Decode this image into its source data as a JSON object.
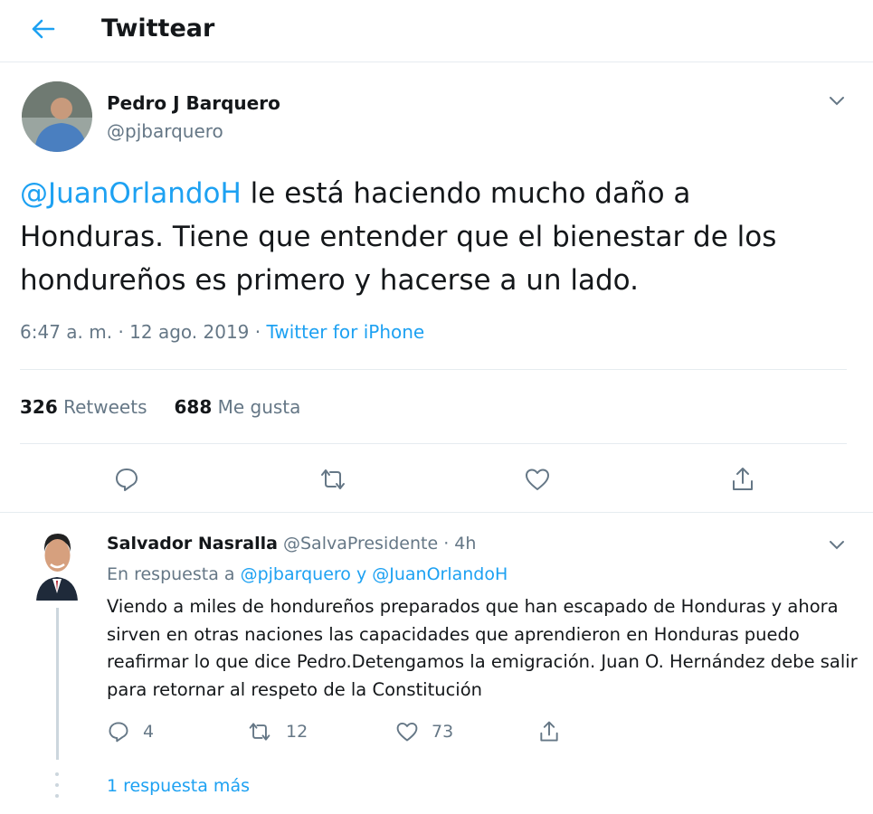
{
  "header": {
    "title": "Twittear"
  },
  "tweet": {
    "author_name": "Pedro J Barquero",
    "author_handle": "@pjbarquero",
    "mention": "@JuanOrlandoH",
    "text": " le está haciendo mucho daño a Honduras. Tiene que entender que el bienestar de los hondureños es primero y hacerse a un lado.",
    "time": "6:47 a. m. · 12 ago. 2019 · ",
    "source": "Twitter for iPhone",
    "retweets_count": "326",
    "retweets_label": "Retweets",
    "likes_count": "688",
    "likes_label": "Me gusta"
  },
  "reply": {
    "author_name": "Salvador Nasralla",
    "author_handle": "@SalvaPresidente · 4h",
    "in_reply_prefix": "En respuesta a ",
    "in_reply_mentions": "@pjbarquero y @JuanOrlandoH",
    "text": "Viendo a miles de hondureños preparados que han escapado de Honduras y ahora sirven en otras naciones las capacidades que aprendieron en Honduras puedo  reafirmar lo que dice Pedro.Detengamos la emigración. Juan O. Hernández debe salir para retornar al respeto de la Constitución",
    "replies_count": "4",
    "retweets_count": "12",
    "likes_count": "73",
    "more_replies": "1 respuesta más"
  },
  "icons": {
    "back": "back-arrow-icon",
    "chevron": "chevron-down-icon",
    "reply": "reply-icon",
    "retweet": "retweet-icon",
    "like": "heart-icon",
    "share": "share-icon"
  },
  "colors": {
    "accent": "#1da1f2",
    "secondary_text": "#657786",
    "border": "#e6ecf0"
  }
}
